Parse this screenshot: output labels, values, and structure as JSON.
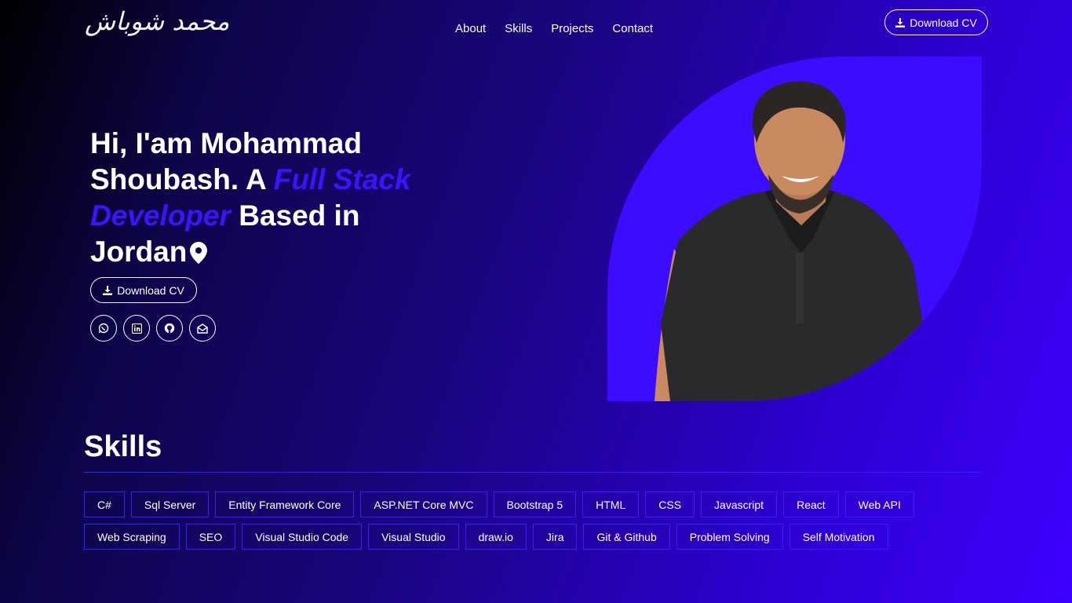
{
  "brand": {
    "logo_text": "محمد شوباش"
  },
  "nav": {
    "items": [
      "About",
      "Skills",
      "Projects",
      "Contact"
    ]
  },
  "header": {
    "cv_label": "Download CV"
  },
  "hero": {
    "greeting": "Hi, I'am ",
    "name": "Mohammad Shoubash",
    "mid": ". A ",
    "role": "Full Stack Developer",
    "based": " Based in ",
    "location": "Jordan",
    "cv_label": "Download CV",
    "socials": [
      "whatsapp-icon",
      "linkedin-icon",
      "github-icon",
      "email-icon"
    ]
  },
  "skills": {
    "title": "Skills",
    "items": [
      "C#",
      "Sql Server",
      "Entity Framework Core",
      "ASP.NET Core MVC",
      "Bootstrap 5",
      "HTML",
      "CSS",
      "Javascript",
      "React",
      "Web API",
      "Web Scraping",
      "SEO",
      "Visual Studio Code",
      "Visual Studio",
      "draw.io",
      "Jira",
      "Git & Github",
      "Problem Solving",
      "Self Motivation"
    ]
  },
  "colors": {
    "accent": "#3a14ff",
    "photo_bg": "#3d0bff"
  }
}
